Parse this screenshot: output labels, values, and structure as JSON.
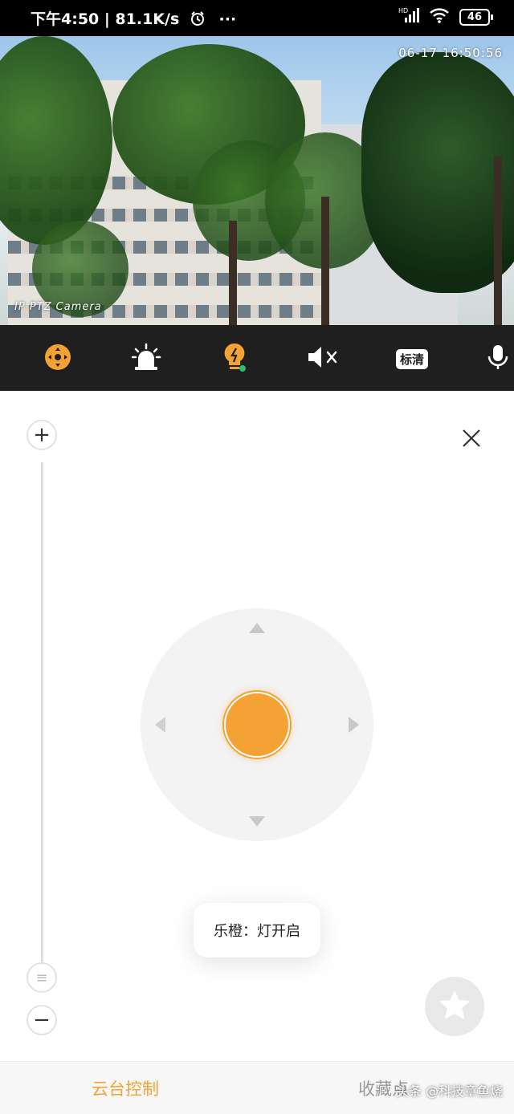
{
  "status_bar": {
    "time_net": "下午4:50 | 81.1K/s",
    "alarm_icon": "alarm-clock-icon",
    "more_glyph": "···",
    "network_tag": "HD",
    "battery": "46"
  },
  "camera": {
    "timestamp": "06-17 16:50:56",
    "label": "IP PTZ Camera"
  },
  "toolbar": {
    "hd_label": "标清",
    "accent_color": "#f4a233",
    "icons": [
      "ptz-control-icon",
      "siren-icon",
      "light-bulb-icon",
      "mute-icon",
      "quality-icon",
      "microphone-icon"
    ]
  },
  "ptz": {
    "zoom_in": "+",
    "zoom_out": "−",
    "zoom_handle": "≡",
    "close": "✕"
  },
  "toast": {
    "text": "乐橙：灯开启"
  },
  "tabs": {
    "ptz_control": "云台控制",
    "favorites": "收藏点"
  },
  "watermark": "头条 @科技章鱼烧"
}
